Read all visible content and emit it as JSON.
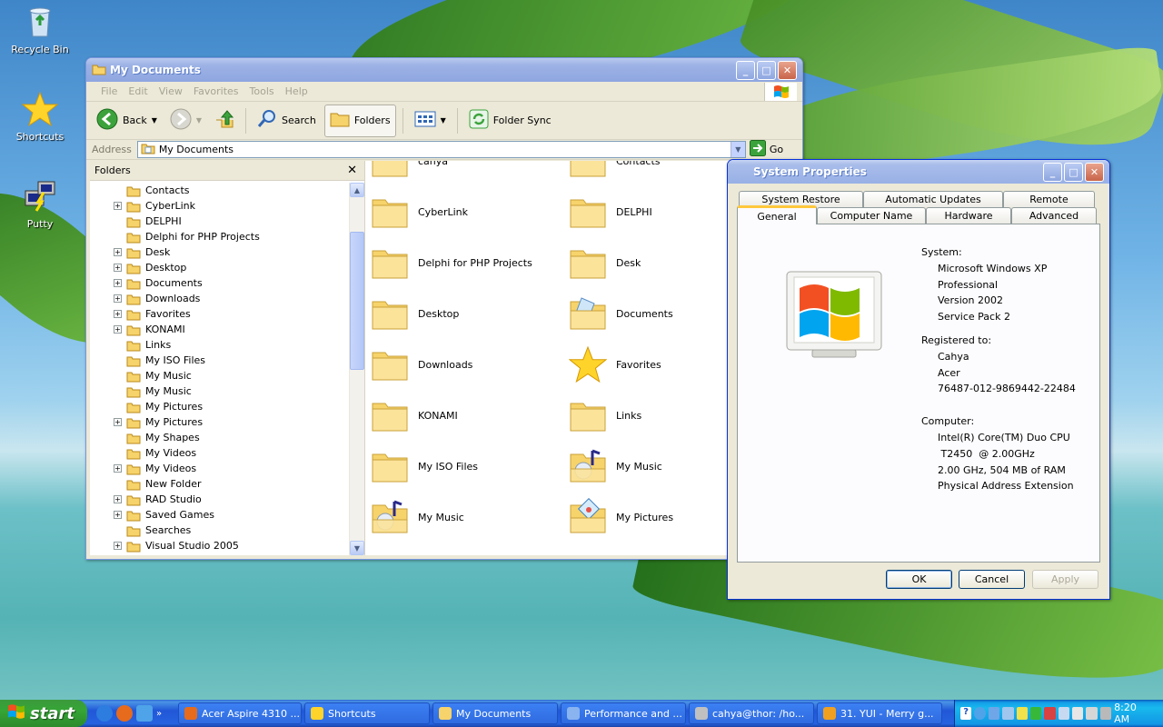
{
  "desktop": {
    "icons": [
      {
        "label": "Recycle Bin",
        "icon": "recycle-bin-icon"
      },
      {
        "label": "Shortcuts",
        "icon": "star-icon"
      },
      {
        "label": "Putty",
        "icon": "putty-icon"
      }
    ]
  },
  "mydocs": {
    "title": "My Documents",
    "menu": [
      "File",
      "Edit",
      "View",
      "Favorites",
      "Tools",
      "Help"
    ],
    "toolbar": {
      "back": "Back",
      "search": "Search",
      "folders": "Folders",
      "folder_sync": "Folder Sync"
    },
    "address": {
      "label": "Address",
      "value": "My Documents",
      "go": "Go"
    },
    "folders_pane": {
      "title": "Folders",
      "items": [
        {
          "label": "Contacts",
          "expandable": false
        },
        {
          "label": "CyberLink",
          "expandable": true
        },
        {
          "label": "DELPHI",
          "expandable": false
        },
        {
          "label": "Delphi for PHP Projects",
          "expandable": false
        },
        {
          "label": "Desk",
          "expandable": true
        },
        {
          "label": "Desktop",
          "expandable": true
        },
        {
          "label": "Documents",
          "expandable": true
        },
        {
          "label": "Downloads",
          "expandable": true
        },
        {
          "label": "Favorites",
          "expandable": true
        },
        {
          "label": "KONAMI",
          "expandable": true
        },
        {
          "label": "Links",
          "expandable": false
        },
        {
          "label": "My ISO Files",
          "expandable": false
        },
        {
          "label": "My Music",
          "expandable": false
        },
        {
          "label": "My Music",
          "expandable": false
        },
        {
          "label": "My Pictures",
          "expandable": false
        },
        {
          "label": "My Pictures",
          "expandable": true
        },
        {
          "label": "My Shapes",
          "expandable": false
        },
        {
          "label": "My Videos",
          "expandable": false
        },
        {
          "label": "My Videos",
          "expandable": true
        },
        {
          "label": "New Folder",
          "expandable": false
        },
        {
          "label": "RAD Studio",
          "expandable": true
        },
        {
          "label": "Saved Games",
          "expandable": true
        },
        {
          "label": "Searches",
          "expandable": false
        },
        {
          "label": "Visual Studio 2005",
          "expandable": true
        }
      ]
    },
    "files": [
      {
        "label": "cahya",
        "icon": "folder-icon"
      },
      {
        "label": "Contacts",
        "icon": "folder-icon"
      },
      {
        "label": "CyberLink",
        "icon": "folder-icon"
      },
      {
        "label": "DELPHI",
        "icon": "folder-icon"
      },
      {
        "label": "Delphi for PHP Projects",
        "icon": "folder-icon"
      },
      {
        "label": "Desk",
        "icon": "folder-icon"
      },
      {
        "label": "Desktop",
        "icon": "folder-icon"
      },
      {
        "label": "Documents",
        "icon": "documents-folder-icon"
      },
      {
        "label": "Downloads",
        "icon": "folder-icon"
      },
      {
        "label": "Favorites",
        "icon": "star-icon"
      },
      {
        "label": "KONAMI",
        "icon": "folder-icon"
      },
      {
        "label": "Links",
        "icon": "folder-icon"
      },
      {
        "label": "My ISO Files",
        "icon": "folder-icon"
      },
      {
        "label": "My Music",
        "icon": "music-folder-icon"
      },
      {
        "label": "My Music",
        "icon": "music-folder-icon"
      },
      {
        "label": "My Pictures",
        "icon": "pictures-folder-icon"
      }
    ]
  },
  "sysprops": {
    "title": "System Properties",
    "tabs_back": [
      "System Restore",
      "Automatic Updates",
      "Remote"
    ],
    "tabs_front": [
      "General",
      "Computer Name",
      "Hardware",
      "Advanced"
    ],
    "active_tab": "General",
    "system_label": "System:",
    "system": [
      "Microsoft Windows XP",
      "Professional",
      "Version 2002",
      "Service Pack 2"
    ],
    "registered_label": "Registered to:",
    "registered": [
      "Cahya",
      "Acer",
      "76487-012-9869442-22484"
    ],
    "computer_label": "Computer:",
    "computer": [
      "Intel(R) Core(TM) Duo CPU",
      " T2450  @ 2.00GHz",
      "2.00 GHz, 504 MB of RAM",
      "Physical Address Extension"
    ],
    "buttons": {
      "ok": "OK",
      "cancel": "Cancel",
      "apply": "Apply"
    }
  },
  "taskbar": {
    "start": "start",
    "tasks": [
      {
        "label": "Acer Aspire 4310 ...",
        "icon": "firefox-icon"
      },
      {
        "label": "Shortcuts",
        "icon": "star-icon"
      },
      {
        "label": "My Documents",
        "icon": "folder-icon"
      },
      {
        "label": "Performance and ...",
        "icon": "control-panel-icon"
      },
      {
        "label": "cahya@thor: /ho...",
        "icon": "putty-icon"
      },
      {
        "label": "31. YUI - Merry g...",
        "icon": "media-player-icon"
      }
    ],
    "clock": "8:20 AM"
  },
  "colors": {
    "xp_blue": "#0831d9",
    "start_green": "#35a535",
    "taskbar_blue": "#2157d7",
    "tab_highlight": "#ffc83c",
    "folder_yellow": "#f7d36b"
  }
}
